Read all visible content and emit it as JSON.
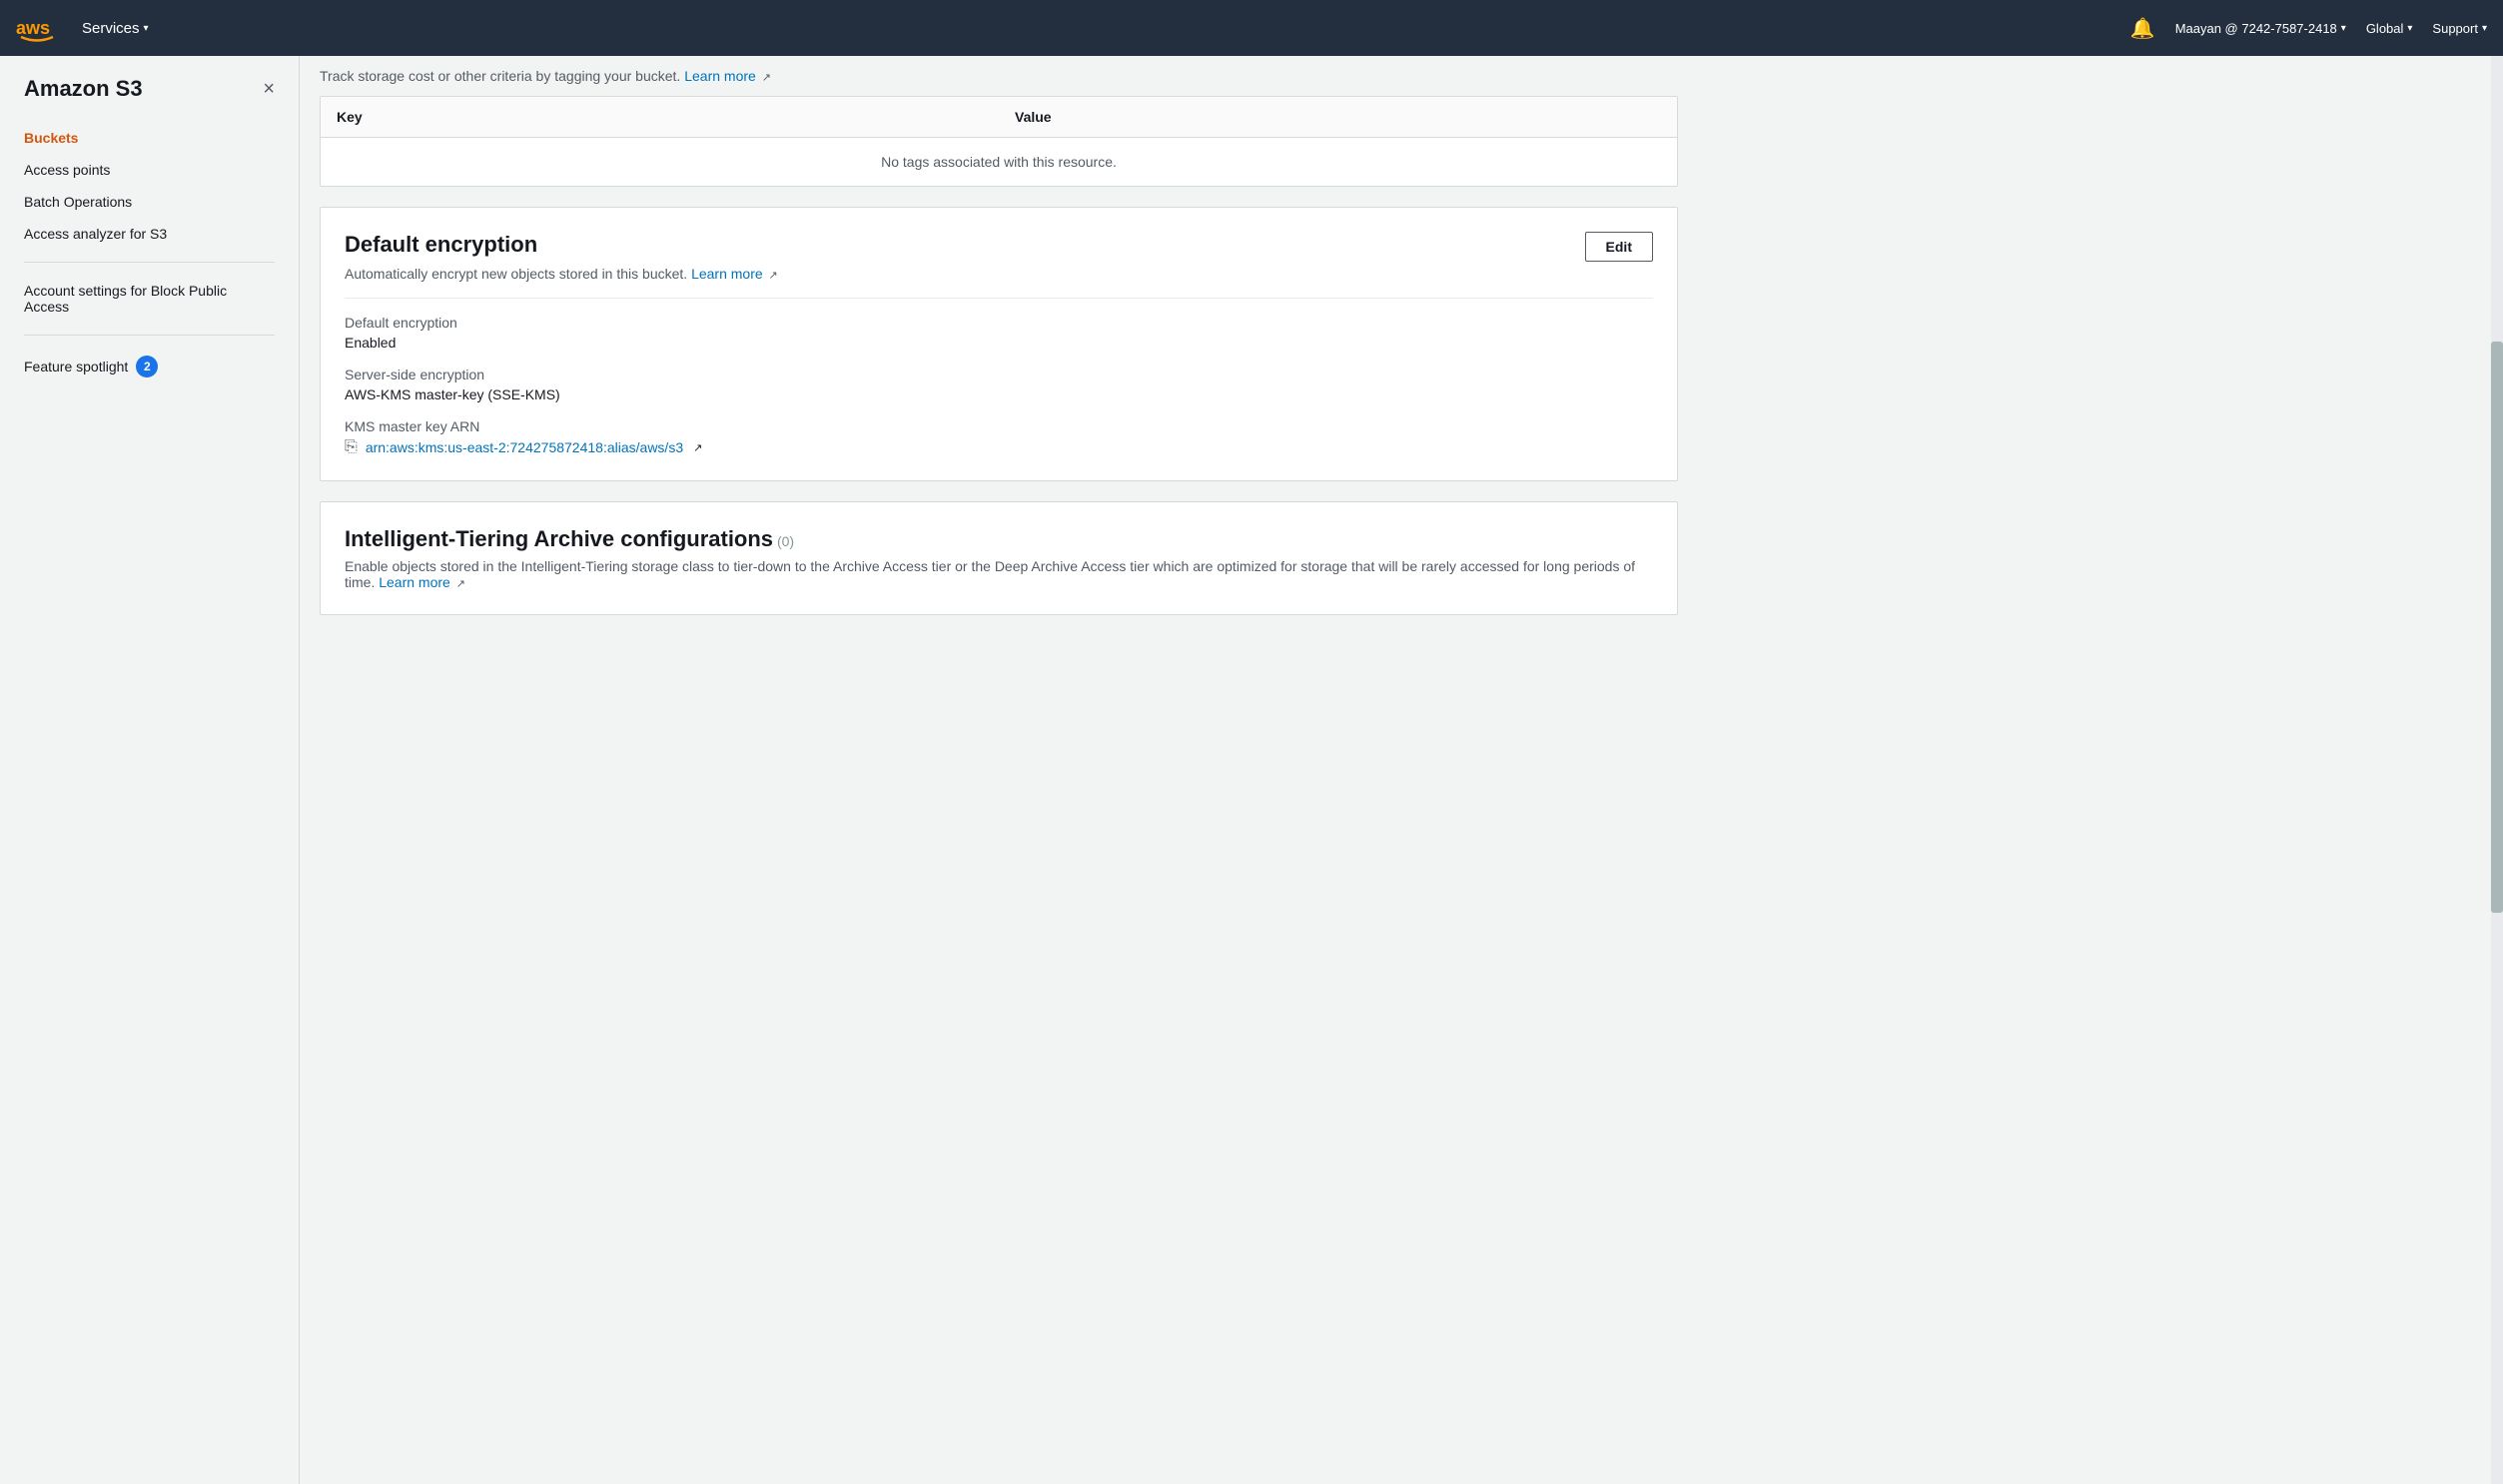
{
  "topnav": {
    "services_label": "Services",
    "caret": "▾",
    "user": "Maayan @ 7242-7587-2418",
    "global": "Global",
    "support": "Support",
    "bell_icon": "🔔"
  },
  "sidebar": {
    "title": "Amazon S3",
    "close_label": "×",
    "nav_items": [
      {
        "id": "buckets",
        "label": "Buckets",
        "active": true
      },
      {
        "id": "access-points",
        "label": "Access points",
        "active": false
      },
      {
        "id": "batch-operations",
        "label": "Batch Operations",
        "active": false
      },
      {
        "id": "access-analyzer",
        "label": "Access analyzer for S3",
        "active": false
      }
    ],
    "section_items": [
      {
        "id": "block-public-access",
        "label": "Account settings for Block Public Access"
      }
    ],
    "feature_spotlight": {
      "label": "Feature spotlight",
      "badge": "2"
    }
  },
  "main": {
    "tags_info": "Track storage cost or other criteria by tagging your bucket.",
    "tags_learn_more": "Learn more",
    "tags_table": {
      "columns": [
        "Key",
        "Value"
      ],
      "empty_message": "No tags associated with this resource."
    },
    "default_encryption": {
      "title": "Default encryption",
      "subtitle": "Automatically encrypt new objects stored in this bucket.",
      "learn_more": "Learn more",
      "edit_label": "Edit",
      "fields": [
        {
          "label": "Default encryption",
          "value": "Enabled"
        },
        {
          "label": "Server-side encryption",
          "value": "AWS-KMS master-key (SSE-KMS)"
        },
        {
          "label": "KMS master key ARN",
          "value": "arn:aws:kms:us-east-2:724275872418:alias/aws/s3"
        }
      ]
    },
    "intelligent_tiering": {
      "title": "Intelligent-Tiering Archive configurations",
      "count": "(0)",
      "description": "Enable objects stored in the Intelligent-Tiering storage class to tier-down to the Archive Access tier or the Deep Archive Access tier which are optimized for storage that will be rarely accessed for long periods of time.",
      "learn_more": "Learn more"
    }
  }
}
